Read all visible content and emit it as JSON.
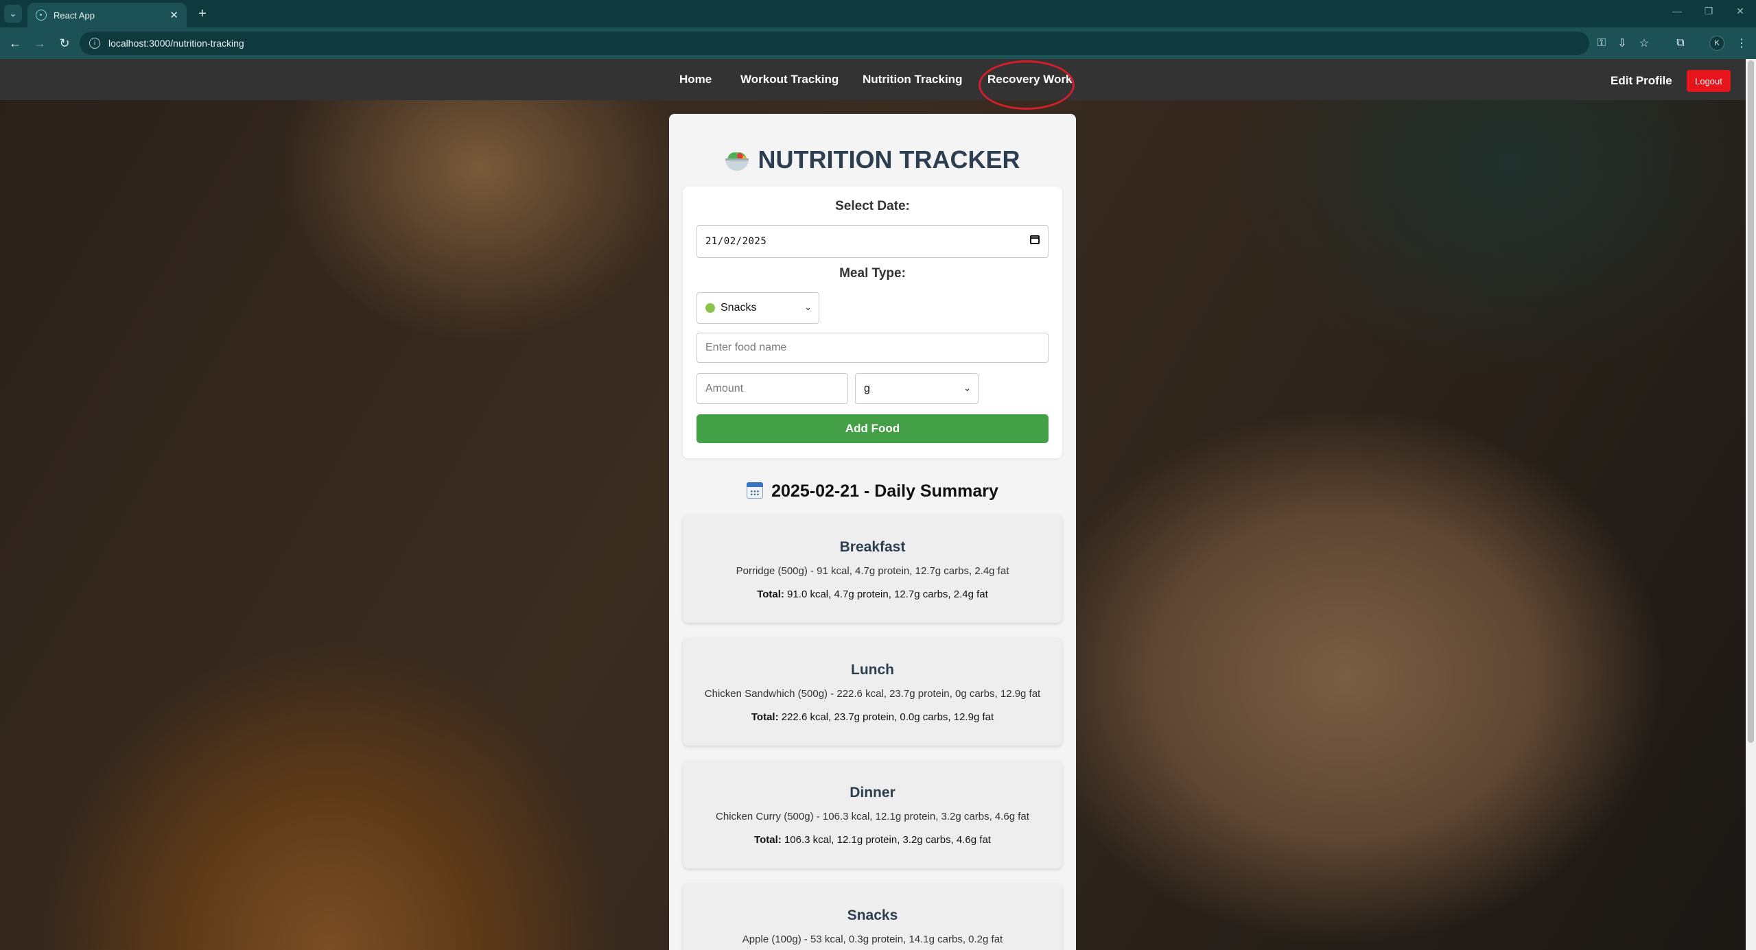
{
  "browser": {
    "tab_title": "React App",
    "url": "localhost:3000/nutrition-tracking",
    "profile_initial": "K"
  },
  "nav": {
    "links": [
      "Home",
      "Workout Tracking",
      "Nutrition Tracking",
      "Recovery Work"
    ],
    "edit_profile": "Edit Profile",
    "logout": "Logout"
  },
  "tracker": {
    "title": "NUTRITION TRACKER",
    "date_label": "Select Date:",
    "date_value": "21/02/2025",
    "meal_type_label": "Meal Type:",
    "meal_type_value": "Snacks",
    "food_placeholder": "Enter food name",
    "amount_placeholder": "Amount",
    "unit_value": "g",
    "add_button": "Add Food"
  },
  "summary": {
    "title": "2025-02-21 - Daily Summary",
    "total_label": "Total:",
    "meals": [
      {
        "name": "Breakfast",
        "item": "Porridge (500g) - 91 kcal, 4.7g protein, 12.7g carbs, 2.4g fat",
        "total": "91.0 kcal, 4.7g protein, 12.7g carbs, 2.4g fat"
      },
      {
        "name": "Lunch",
        "item": "Chicken Sandwhich (500g) - 222.6 kcal, 23.7g protein, 0g carbs, 12.9g fat",
        "total": "222.6 kcal, 23.7g protein, 0.0g carbs, 12.9g fat"
      },
      {
        "name": "Dinner",
        "item": "Chicken Curry (500g) - 106.3 kcal, 12.1g protein, 3.2g carbs, 4.6g fat",
        "total": "106.3 kcal, 12.1g protein, 3.2g carbs, 4.6g fat"
      },
      {
        "name": "Snacks",
        "item": "Apple (100g) - 53 kcal, 0.3g protein, 14.1g carbs, 0.2g fat",
        "total": ""
      }
    ]
  },
  "colors": {
    "navbar": "#333333",
    "logout": "#e8141c",
    "add_button": "#43a047",
    "highlight_ring": "#d21f2a",
    "title": "#2c3e50"
  }
}
